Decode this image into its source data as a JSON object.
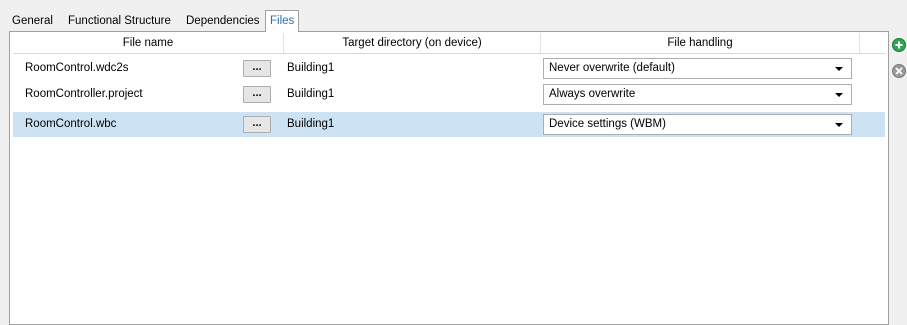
{
  "tabs": [
    {
      "label": "General"
    },
    {
      "label": "Functional Structure"
    },
    {
      "label": "Dependencies"
    },
    {
      "label": "Files",
      "active": true
    }
  ],
  "table": {
    "columns": [
      "File name",
      "Target directory (on device)",
      "File handling"
    ],
    "browse_label": "...",
    "rows": [
      {
        "file_name": "RoomControl.wdc2s",
        "target": "Building1",
        "handling": "Never overwrite (default)",
        "selected": false
      },
      {
        "file_name": "RoomController.project",
        "target": "Building1",
        "handling": "Always overwrite",
        "selected": false
      },
      {
        "file_name": "RoomControl.wbc",
        "target": "Building1",
        "handling": "Device settings (WBM)",
        "selected": true
      }
    ]
  },
  "side_actions": {
    "add_icon": "plus-circle-icon",
    "remove_icon": "x-circle-icon",
    "add_color": "#2fa84f",
    "remove_color": "#9a9a9a"
  }
}
